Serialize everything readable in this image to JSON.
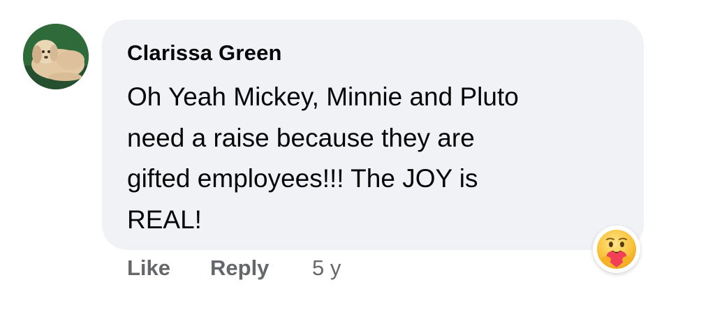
{
  "comment": {
    "author": "Clarissa Green",
    "text_lines": [
      "Oh Yeah Mickey, Minnie and Pluto",
      "need a raise because they are",
      "gifted employees!!! The JOY is",
      "REAL!"
    ],
    "reaction_icon": "care-reaction-icon",
    "avatar": "dog-photo-avatar"
  },
  "actions": {
    "like_label": "Like",
    "reply_label": "Reply",
    "timestamp": "5 y"
  },
  "colors": {
    "bubble": "#f0f2f5",
    "text": "#050505",
    "secondary": "#65676b",
    "reaction_yellow": "#f7b125",
    "reaction_red": "#f33e58"
  }
}
